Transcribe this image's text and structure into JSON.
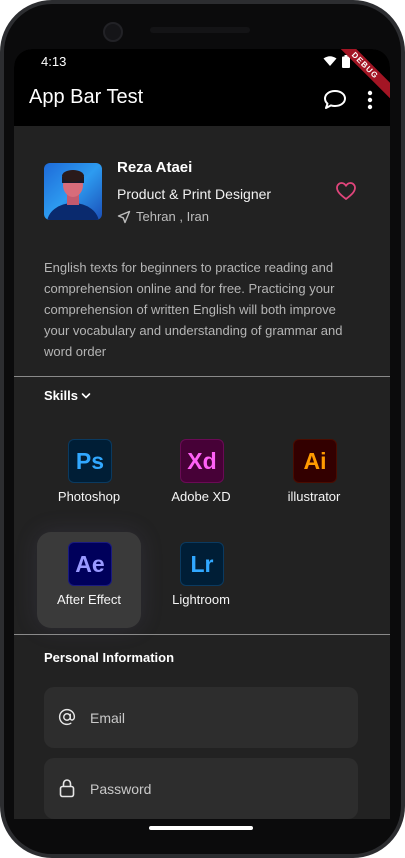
{
  "status_bar": {
    "time": "4:13"
  },
  "app_bar": {
    "title": "App Bar Test",
    "debug_banner": "DEBUG"
  },
  "profile": {
    "name": "Reza Ataei",
    "role": "Product & Print Designer",
    "location": "Tehran , Iran",
    "bio": "English texts for beginners to practice reading and comprehension online and for free. Practicing your comprehension of written English will both improve your vocabulary and understanding of grammar and word order"
  },
  "skills": {
    "label": "Skills",
    "items": [
      {
        "abbr": "Ps",
        "label": "Photoshop",
        "bg": "#001e36",
        "fg": "#31a8ff"
      },
      {
        "abbr": "Xd",
        "label": "Adobe XD",
        "bg": "#470137",
        "fg": "#ff61f6"
      },
      {
        "abbr": "Ai",
        "label": "illustrator",
        "bg": "#330000",
        "fg": "#ff9a00"
      },
      {
        "abbr": "Ae",
        "label": "After Effect",
        "bg": "#00005b",
        "fg": "#9999ff",
        "selected": true
      },
      {
        "abbr": "Lr",
        "label": "Lightroom",
        "bg": "#001e36",
        "fg": "#31a8ff"
      }
    ]
  },
  "personal_info": {
    "label": "Personal Information",
    "email_placeholder": "Email",
    "password_placeholder": "Password"
  },
  "colors": {
    "heart": "#e0457b",
    "appbar": "#000000",
    "background": "#222222"
  }
}
